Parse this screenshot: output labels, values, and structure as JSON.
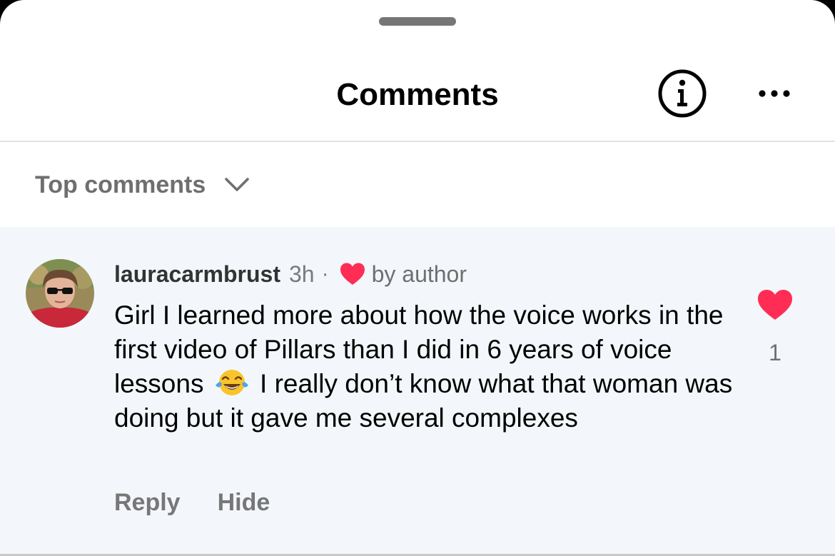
{
  "header": {
    "title": "Comments",
    "info_icon": "info-circle-icon",
    "more_icon": "more-horizontal-icon"
  },
  "sort": {
    "label": "Top comments",
    "icon": "chevron-down-icon"
  },
  "comment": {
    "username": "lauracarmbrust",
    "time": "3h",
    "separator": "·",
    "liked_by_author_icon": "heart-icon",
    "liked_by_author_label": "by author",
    "text_before_emoji": "Girl I learned more about how the voice works in the first video of Pillars than I did in 6 years of voice lessons",
    "emoji": "face-with-tears-of-joy-icon",
    "text_after_emoji": "I really don’t know what that woman was doing but it gave me several complexes",
    "reply_label": "Reply",
    "hide_label": "Hide",
    "like_count": "1",
    "liked": true
  },
  "colors": {
    "heart_red": "#ff2d55",
    "comment_background": "#f3f7fb",
    "secondary_text": "#6f6f6f"
  }
}
